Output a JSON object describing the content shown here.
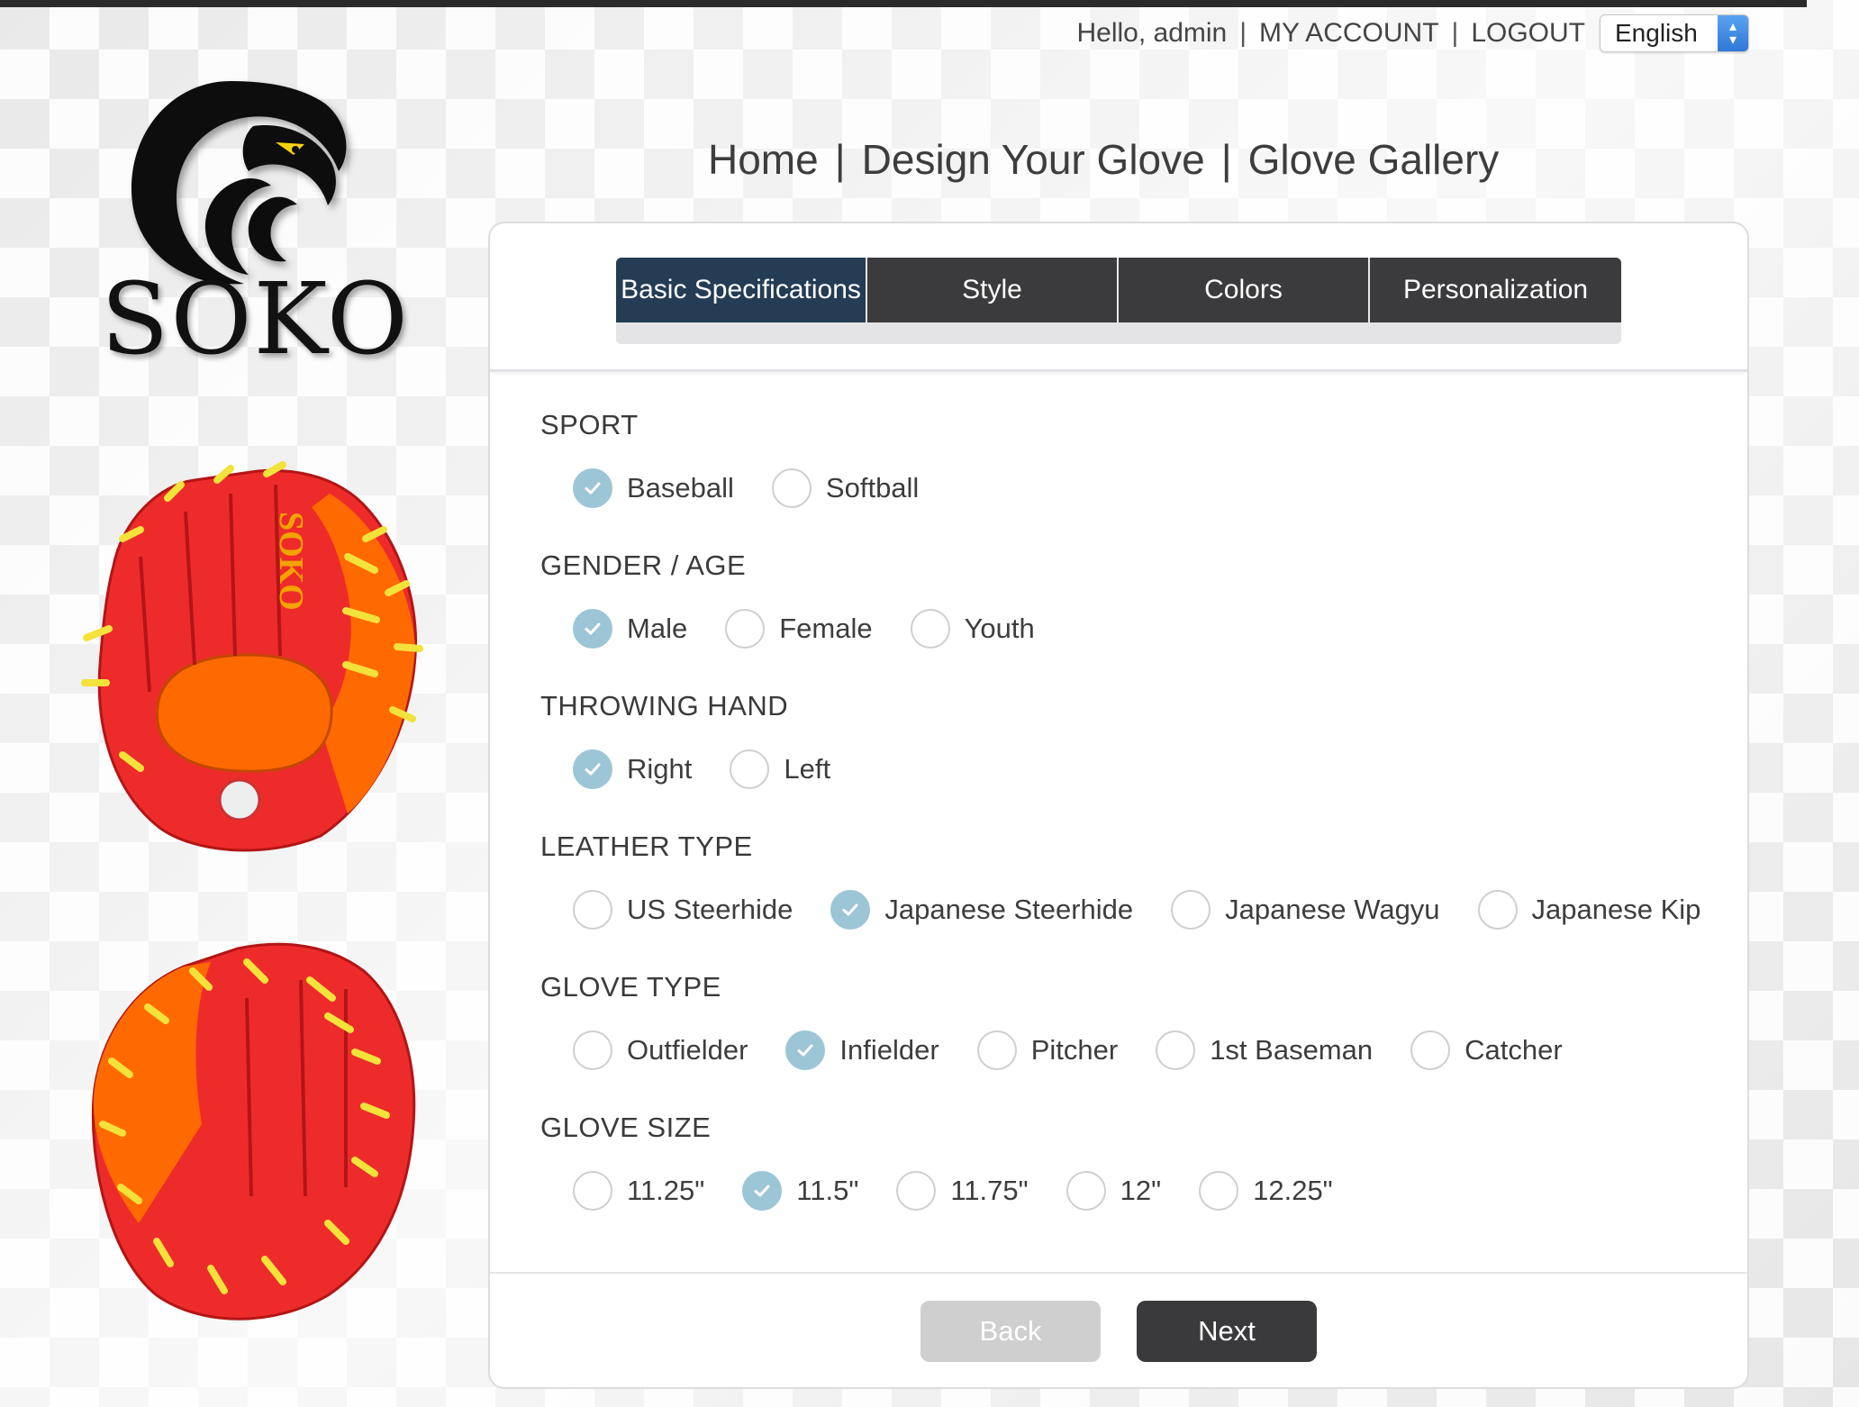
{
  "header": {
    "greeting": "Hello, admin",
    "my_account": "MY ACCOUNT",
    "logout": "LOGOUT",
    "language": "English"
  },
  "brand": {
    "name": "SOKO",
    "logo_icon": "eagle-head-icon"
  },
  "nav": {
    "home": "Home",
    "design": "Design Your Glove",
    "gallery": "Glove Gallery"
  },
  "tabs": [
    {
      "label": "Basic Specifications",
      "active": true
    },
    {
      "label": "Style",
      "active": false
    },
    {
      "label": "Colors",
      "active": false
    },
    {
      "label": "Personalization",
      "active": false
    }
  ],
  "sections": {
    "sport": {
      "title": "SPORT",
      "options": [
        "Baseball",
        "Softball"
      ],
      "selected": "Baseball"
    },
    "gender": {
      "title": "GENDER / AGE",
      "options": [
        "Male",
        "Female",
        "Youth"
      ],
      "selected": "Male"
    },
    "hand": {
      "title": "THROWING HAND",
      "options": [
        "Right",
        "Left"
      ],
      "selected": "Right"
    },
    "leather": {
      "title": "LEATHER TYPE",
      "options": [
        "US Steerhide",
        "Japanese Steerhide",
        "Japanese Wagyu",
        "Japanese Kip"
      ],
      "selected": "Japanese Steerhide"
    },
    "glove_type": {
      "title": "GLOVE TYPE",
      "options": [
        "Outfielder",
        "Infielder",
        "Pitcher",
        "1st Baseman",
        "Catcher"
      ],
      "selected": "Infielder"
    },
    "size": {
      "title": "GLOVE SIZE",
      "options": [
        "11.25\"",
        "11.5\"",
        "11.75\"",
        "12\"",
        "12.25\""
      ],
      "selected": "11.5\""
    }
  },
  "buttons": {
    "back": "Back",
    "next": "Next"
  },
  "colors": {
    "tab_active": "#243c54",
    "tab": "#3b3b3d",
    "radio_checked": "#9cc6d6",
    "glove_red": "#ee2b2b",
    "glove_orange": "#ff6a00",
    "lace_yellow": "#f2e23a"
  }
}
